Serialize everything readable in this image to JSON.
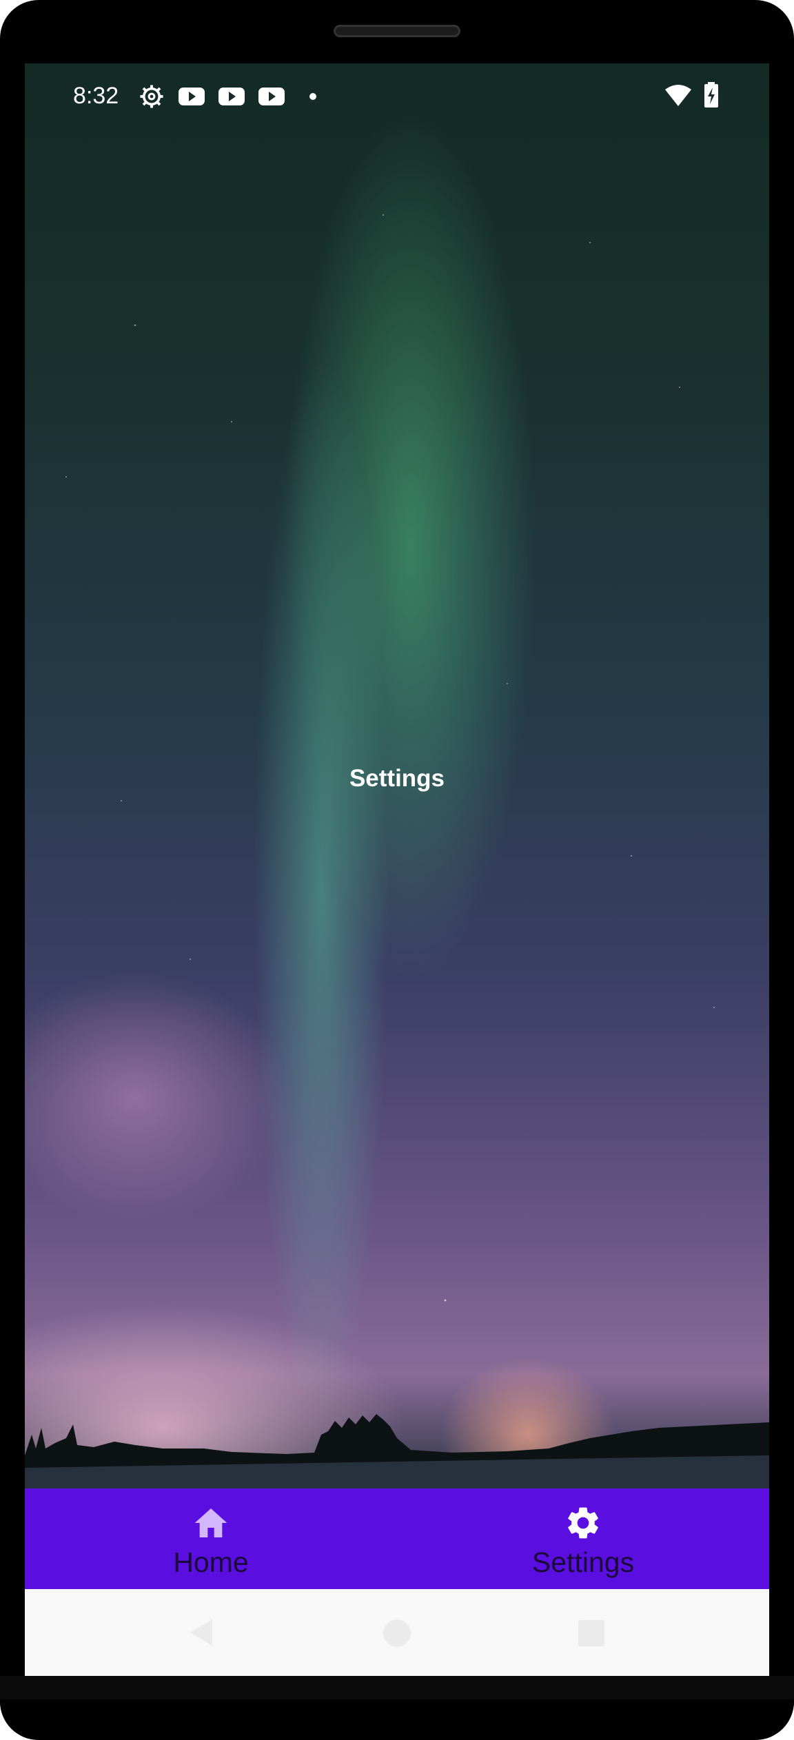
{
  "status_bar": {
    "time": "8:32",
    "left_icons": [
      "settings-gear-icon",
      "youtube-icon",
      "youtube-icon",
      "youtube-icon",
      "notification-dot-icon"
    ],
    "right_icons": [
      "wifi-icon",
      "battery-charging-icon"
    ]
  },
  "main": {
    "title": "Settings"
  },
  "bottom_nav": {
    "items": [
      {
        "label": "Home",
        "icon": "home-icon"
      },
      {
        "label": "Settings",
        "icon": "gear-icon"
      }
    ],
    "background": "#5a0fe0",
    "active_icon_color": "#d4b8ff",
    "selected_icon_color": "#ffffff"
  },
  "system_nav": {
    "buttons": [
      "back-icon",
      "home-circle-icon",
      "recents-icon"
    ]
  }
}
